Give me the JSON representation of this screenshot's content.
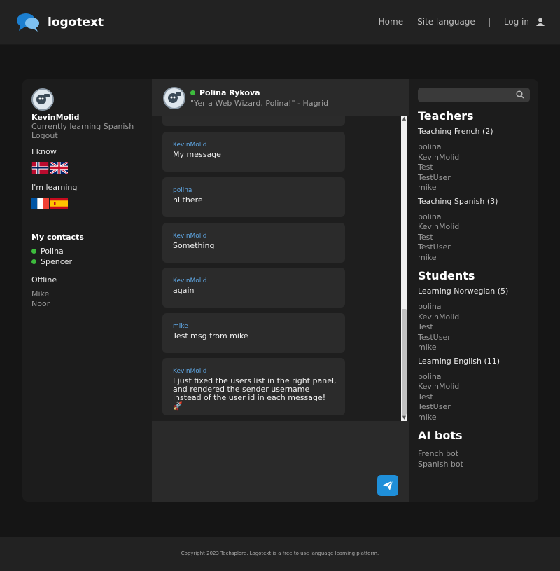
{
  "header": {
    "logo_text": "logotext",
    "nav": {
      "home": "Home",
      "site_language": "Site language",
      "login": "Log in"
    }
  },
  "profile": {
    "username": "KevinMolid",
    "learning_status": "Currently learning Spanish",
    "logout": "Logout",
    "i_know_label": "I know",
    "i_know_flags": [
      "norwegian-flag",
      "uk-flag"
    ],
    "learning_label": "I'm learning",
    "learning_flags": [
      "french-flag",
      "spanish-flag"
    ]
  },
  "contacts": {
    "title": "My contacts",
    "online": [
      "Polina",
      "Spencer"
    ],
    "offline_label": "Offline",
    "offline": [
      "Mike",
      "Noor"
    ]
  },
  "chat": {
    "peer_name": "Polina Rykova",
    "peer_status": "\"Yer a Web Wizard, Polina!\" - Hagrid",
    "messages": [
      {
        "sender": "KevinMolid",
        "text": "My message"
      },
      {
        "sender": "polina",
        "text": "hi there"
      },
      {
        "sender": "KevinMolid",
        "text": "Something"
      },
      {
        "sender": "KevinMolid",
        "text": "again"
      },
      {
        "sender": "mike",
        "text": "Test msg from mike"
      },
      {
        "sender": "KevinMolid",
        "text": "I just fixed the users list in the right panel, and rendered the sender username instead of the user id in each message! 🚀"
      }
    ],
    "send_icon": "paper-plane-icon"
  },
  "sidebar": {
    "search_placeholder": "",
    "teachers": {
      "title": "Teachers",
      "groups": [
        {
          "label": "Teaching French (2)",
          "users": [
            "polina",
            "KevinMolid",
            "Test",
            "TestUser",
            "mike"
          ]
        },
        {
          "label": "Teaching Spanish (3)",
          "users": [
            "polina",
            "KevinMolid",
            "Test",
            "TestUser",
            "mike"
          ]
        }
      ]
    },
    "students": {
      "title": "Students",
      "groups": [
        {
          "label": "Learning Norwegian (5)",
          "users": [
            "polina",
            "KevinMolid",
            "Test",
            "TestUser",
            "mike"
          ]
        },
        {
          "label": "Learning English (11)",
          "users": [
            "polina",
            "KevinMolid",
            "Test",
            "TestUser",
            "mike"
          ]
        }
      ]
    },
    "bots": {
      "title": "AI bots",
      "items": [
        "French bot",
        "Spanish bot"
      ]
    }
  },
  "footer": {
    "copyright": "Copyright 2023 Techsplore. Logotext is a free to use language learning platform."
  }
}
